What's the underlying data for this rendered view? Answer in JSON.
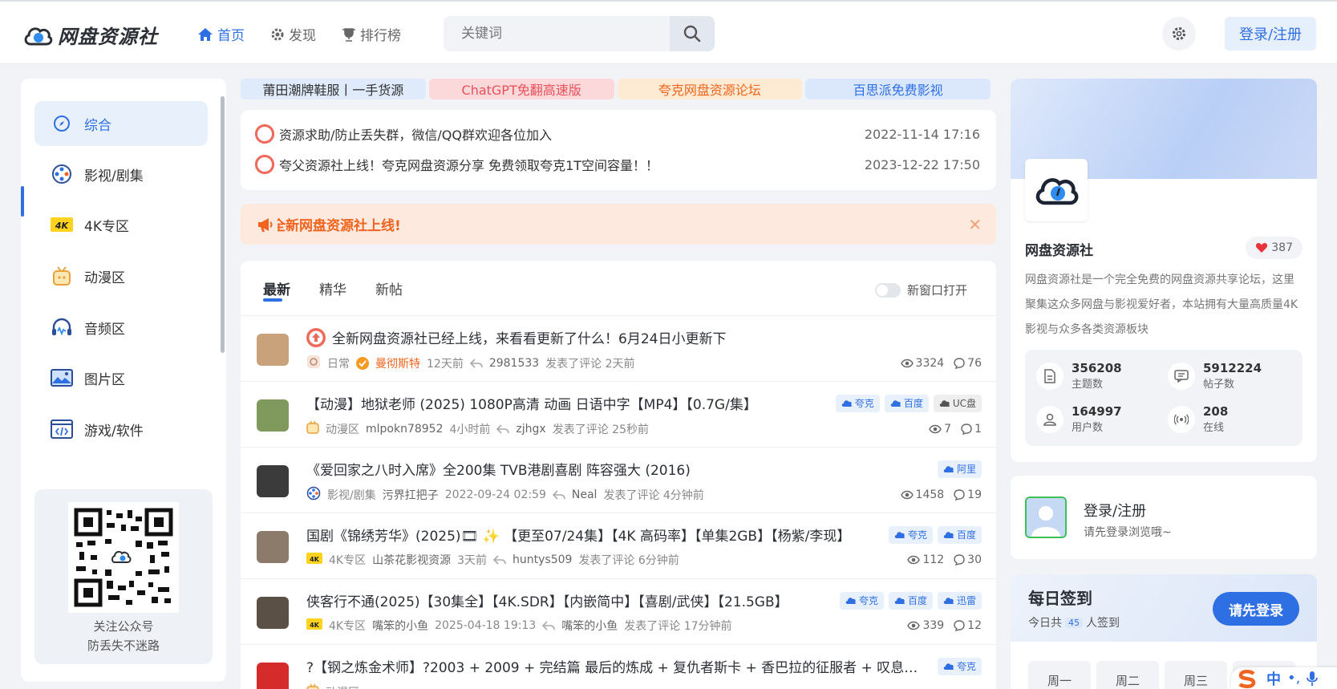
{
  "header": {
    "logo_text": "网盘资源社",
    "nav": [
      {
        "label": "首页",
        "icon": "home-icon",
        "active": true
      },
      {
        "label": "发现",
        "icon": "gear-icon",
        "active": false
      },
      {
        "label": "排行榜",
        "icon": "trophy-icon",
        "active": false
      }
    ],
    "search_placeholder": "关键词",
    "login_label": "登录/注册"
  },
  "sidebar": {
    "items": [
      {
        "label": "综合",
        "icon": "compass-icon",
        "active": true
      },
      {
        "label": "影视/剧集",
        "icon": "film-reel-icon",
        "active": false
      },
      {
        "label": "4K专区",
        "icon": "4k-icon",
        "active": false
      },
      {
        "label": "动漫区",
        "icon": "tv-icon",
        "active": false
      },
      {
        "label": "音频区",
        "icon": "headphones-icon",
        "active": false
      },
      {
        "label": "图片区",
        "icon": "image-icon",
        "active": false
      },
      {
        "label": "游戏/软件",
        "icon": "code-icon",
        "active": false
      }
    ],
    "qr_line1": "关注公众号",
    "qr_line2": "防丢失不迷路"
  },
  "ads": [
    {
      "label": "莆田潮牌鞋服丨一手货源",
      "bg": "#dfeafa",
      "color": "#333333"
    },
    {
      "label": "ChatGPT免翻高速版",
      "bg": "#fbd9db",
      "color": "#e8505b"
    },
    {
      "label": "夸克网盘资源论坛",
      "bg": "#fdebd3",
      "color": "#f0641f"
    },
    {
      "label": "百思派免费影视",
      "bg": "#dbe8fb",
      "color": "#2f6fe4"
    }
  ],
  "notices": [
    {
      "text": "资源求助/防止丢失群，微信/QQ群欢迎各位加入",
      "date": "2022-11-14 17:16"
    },
    {
      "text": "夸父资源社上线！夸克网盘资源分享 免费领取夸克1T空间容量！！",
      "date": "2023-12-22 17:50"
    }
  ],
  "banner": {
    "text": "全新网盘资源社上线!"
  },
  "list": {
    "tabs": [
      "最新",
      "精华",
      "新帖"
    ],
    "toggle_label": "新窗口打开",
    "posts": [
      {
        "title": "全新网盘资源社已经上线，来看看更新了什么！6月24日小更新下",
        "pinned": true,
        "tags": [],
        "category": "日常",
        "author": "曼彻斯特",
        "author_verified": true,
        "time": "12天前",
        "replier": "2981533",
        "reply_text": "发表了评论 2天前",
        "views": "3324",
        "comments": "76",
        "thumb": "#c9a27c"
      },
      {
        "title": "【动漫】地狱老师 (2025) 1080P高清 动画 日语中字【MP4】【0.7G/集】",
        "pinned": false,
        "tags": [
          {
            "label": "夸克",
            "style": "blue"
          },
          {
            "label": "百度",
            "style": "blue"
          },
          {
            "label": "UC盘",
            "style": "gray"
          }
        ],
        "category": "动漫区",
        "author": "mlpokn78952",
        "author_verified": false,
        "time": "4小时前",
        "replier": "zjhgx",
        "reply_text": "发表了评论 25秒前",
        "views": "7",
        "comments": "1",
        "thumb": "#7f9a5c"
      },
      {
        "title": "《爱回家之八时入席》全200集 TVB港剧喜剧 阵容强大 (2016)",
        "pinned": false,
        "tags": [
          {
            "label": "阿里",
            "style": "blue"
          }
        ],
        "category": "影视/剧集",
        "author": "污界扛把子",
        "author_verified": false,
        "time": "2022-09-24 02:59",
        "replier": "Neal",
        "reply_text": "发表了评论 4分钟前",
        "views": "1458",
        "comments": "19",
        "thumb": "#3b3b3b"
      },
      {
        "title": "国剧《锦绣芳华》(2025)🎞 ✨ 【更至07/24集】【4K 高码率】【单集2GB】【杨紫/李现】",
        "pinned": false,
        "tags": [
          {
            "label": "夸克",
            "style": "blue"
          },
          {
            "label": "百度",
            "style": "blue"
          }
        ],
        "category": "4K专区",
        "author": "山茶花影视资源",
        "author_verified": false,
        "time": "3天前",
        "replier": "huntys509",
        "reply_text": "发表了评论 6分钟前",
        "views": "112",
        "comments": "30",
        "thumb": "#8c7a6b"
      },
      {
        "title": "侠客行不通(2025)【30集全】【4K.SDR】【内嵌简中】【喜剧/武侠】【21.5GB】",
        "pinned": false,
        "tags": [
          {
            "label": "夸克",
            "style": "blue"
          },
          {
            "label": "百度",
            "style": "blue"
          },
          {
            "label": "迅雷",
            "style": "blue"
          }
        ],
        "category": "4K专区",
        "author": "嘴笨的小鱼",
        "author_verified": false,
        "time": "2025-04-18 19:13",
        "replier": "嘴笨的小鱼",
        "reply_text": "发表了评论 17分钟前",
        "views": "339",
        "comments": "12",
        "thumb": "#5a5046"
      },
      {
        "title": "?【钢之炼金术师】?2003 + 2009 + 完结篇 最后的炼成 + 复仇者斯卡 + 香巴拉的征服者 + 叹息之丘的圣星",
        "pinned": false,
        "tags": [
          {
            "label": "夸克",
            "style": "blue"
          }
        ],
        "category": "动漫区",
        "author": "",
        "author_verified": false,
        "time": "",
        "replier": "",
        "reply_text": "",
        "views": "",
        "comments": "",
        "thumb": "#d62b2b"
      }
    ]
  },
  "profile": {
    "name": "网盘资源社",
    "likes": "387",
    "desc": "网盘资源社是一个完全免费的网盘资源共享论坛，这里聚集这众多网盘与影视爱好者，本站拥有大量高质量4K影视与众多各类资源板块",
    "stats": [
      {
        "num": "356208",
        "label": "主题数",
        "icon": "document-icon"
      },
      {
        "num": "5912224",
        "label": "帖子数",
        "icon": "message-icon"
      },
      {
        "num": "164997",
        "label": "用户数",
        "icon": "users-icon"
      },
      {
        "num": "208",
        "label": "在线",
        "icon": "broadcast-icon"
      }
    ]
  },
  "user_card": {
    "title": "登录/注册",
    "sub": "请先登录浏览哦~"
  },
  "sign": {
    "title": "每日签到",
    "sub_prefix": "今日共",
    "count": "45",
    "sub_suffix": "人签到",
    "button": "请先登录",
    "days": [
      "周一",
      "周二",
      "周三"
    ]
  },
  "float_widget": {
    "label": "中"
  }
}
